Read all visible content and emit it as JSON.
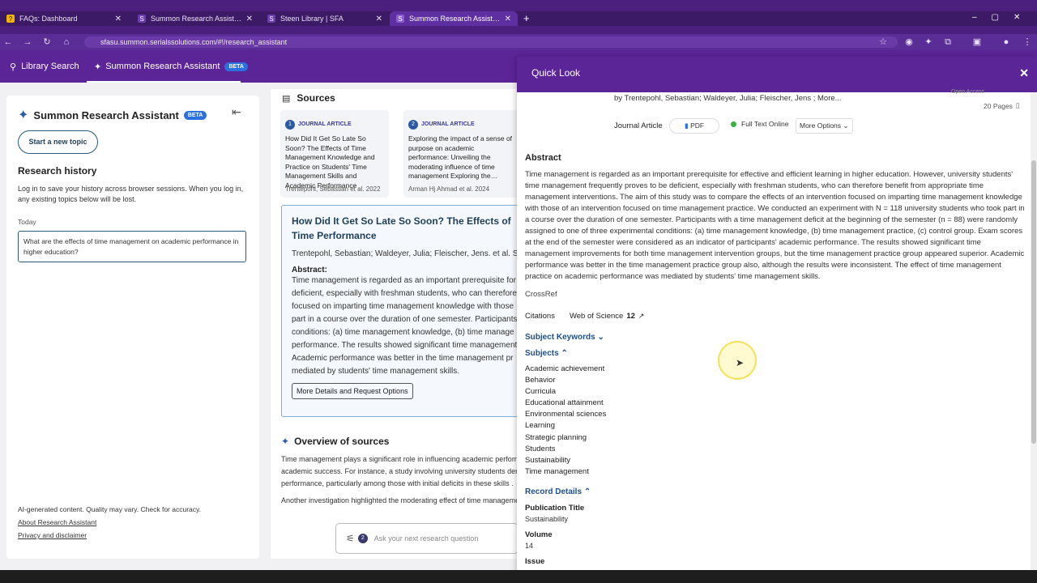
{
  "browser": {
    "tabs": [
      {
        "title": "FAQs: Dashboard",
        "active": false
      },
      {
        "title": "Summon Research Assistant - S",
        "active": false
      },
      {
        "title": "Steen Library | SFA",
        "active": false
      },
      {
        "title": "Summon Research Assistant - S",
        "active": true
      }
    ],
    "new_tab": "+",
    "url": "sfasu.summon.serialssolutions.com/#!/research_assistant"
  },
  "nav": {
    "library_search": "Library Search",
    "research_assistant": "Summon Research Assistant",
    "beta": "BETA"
  },
  "left": {
    "title": "Summon Research Assistant",
    "beta": "BETA",
    "start_topic": "Start a new topic",
    "history_heading": "Research history",
    "history_note": "Log in to save your history across browser sessions. When you log in, any existing topics below will be lost.",
    "today": "Today",
    "history_item": "What are the effects of time management on academic performance in higher education?",
    "footer_note": "AI-generated content. Quality may vary. Check for accuracy.",
    "about_link": "About Research Assistant",
    "privacy_link": "Privacy and disclaimer"
  },
  "middle": {
    "sources_heading": "Sources",
    "cards": [
      {
        "num": "1",
        "type": "JOURNAL ARTICLE",
        "title": "How Did It Get So Late So Soon? The Effects of Time Management Knowledge and Practice on Students' Time Management Skills and Academic Performance",
        "authors": "Trentepohl, Sebastian et al. 2022"
      },
      {
        "num": "2",
        "type": "JOURNAL ARTICLE",
        "title": "Exploring the impact of a sense of purpose on academic performance: Unveiling the moderating influence of time management Exploring the…",
        "authors": "Arman Hj Ahmad et al. 2024"
      }
    ],
    "detail_title": "How Did It Get So Late So Soon? The Effects of Time Performance",
    "detail_authors": "Trentepohl, Sebastian; Waldeyer, Julia; Fleischer, Jens. et al. Su",
    "abstract_label": "Abstract:",
    "abstract_lines": [
      "Time management is regarded as an important prerequisite for",
      "deficient, especially with freshman students, who can therefore",
      "focused on imparting time management knowledge with those",
      "part in a course over the duration of one semester. Participants",
      "conditions: (a) time management knowledge, (b) time manage",
      "performance. The results showed significant time management",
      "Academic performance was better in the time management pr",
      "mediated by students' time management skills."
    ],
    "more_details": "More Details and Request Options",
    "overview_heading": "Overview of sources",
    "overview_lines": [
      "Time management plays a significant role in influencing academic perform",
      "academic success. For instance, a study involving university students demo",
      "performance, particularly among those with initial deficits in these skills .",
      "Another investigation highlighted the moderating effect of time manageme"
    ],
    "ask_placeholder": "Ask your next research question",
    "filter_count": "2"
  },
  "quicklook": {
    "title": "Quick Look",
    "authors": "by Trentepohl, Sebastian; Waldeyer, Julia; Fleischer, Jens ; More...",
    "open_access": "Open Access",
    "pages": "20 Pages",
    "type": "Journal Article",
    "pdf": "PDF",
    "full_text": "Full Text Online",
    "more_options": "More Options",
    "abstract_heading": "Abstract",
    "abstract_text": "Time management is regarded as an important prerequisite for effective and efficient learning in higher education. However, university students' time management frequently proves to be deficient, especially with freshman students, who can therefore benefit from appropriate time management interventions. The aim of this study was to compare the effects of an intervention focused on imparting time management knowledge with those of an intervention focused on time management practice. We conducted an experiment with N = 118 university students who took part in a course over the duration of one semester. Participants with a time management deficit at the beginning of the semester (n = 88) were randomly assigned to one of three experimental conditions: (a) time management knowledge, (b) time management practice, (c) control group. Exam scores at the end of the semester were considered as an indicator of participants' academic performance. The results showed significant time management improvements for both time management intervention groups, but the time management practice group appeared superior. Academic performance was better in the time management practice group also, although the results were inconsistent. The effect of time management practice on academic performance was mediated by students' time management skills.",
    "source": "CrossRef",
    "citations_label": "Citations",
    "citations_source": "Web of Science",
    "citations_count": "12",
    "subject_keywords": "Subject Keywords",
    "subjects_heading": "Subjects",
    "subjects": [
      "Academic achievement",
      "Behavior",
      "Curricula",
      "Educational attainment",
      "Environmental sciences",
      "Learning",
      "Strategic planning",
      "Students",
      "Sustainability",
      "Time management"
    ],
    "record_details": "Record Details",
    "pub_title_label": "Publication Title",
    "pub_title": "Sustainability",
    "volume_label": "Volume",
    "volume": "14",
    "issue_label": "Issue"
  },
  "colors": {
    "brand_purple": "#5b2597",
    "link_blue": "#1d4f8a",
    "accent_blue": "#2b6fe0"
  }
}
